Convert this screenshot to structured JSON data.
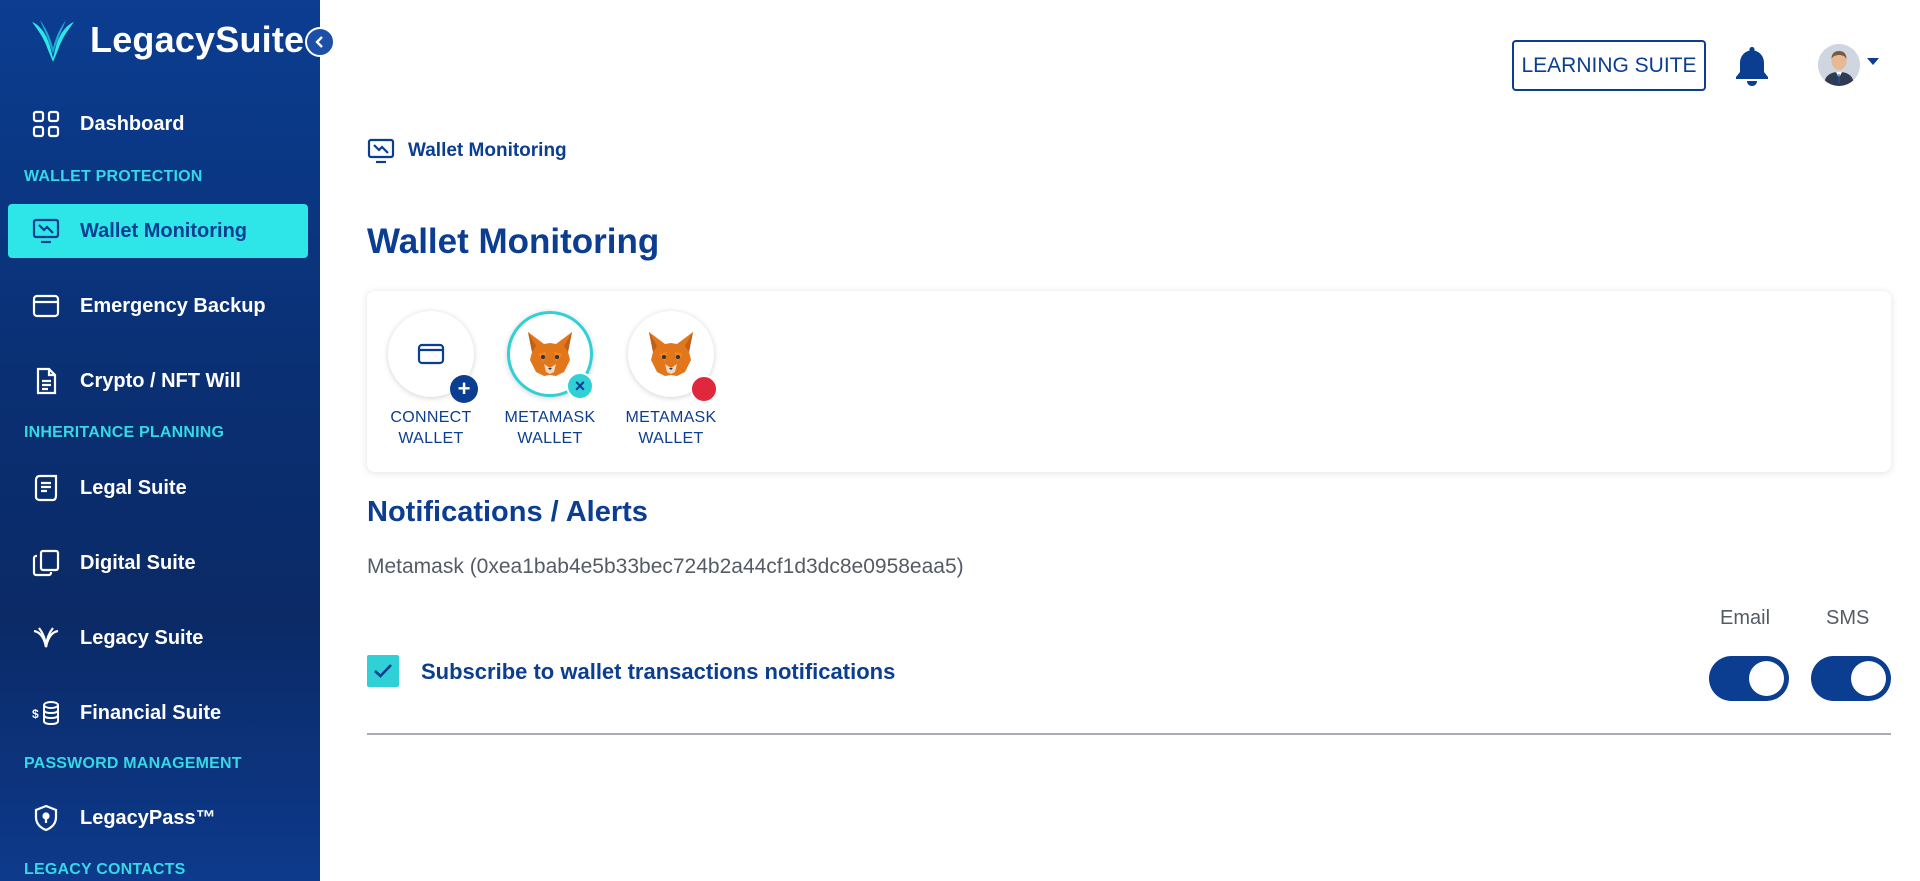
{
  "brand": {
    "name": "LegacySuite"
  },
  "sidebar": {
    "dashboard": "Dashboard",
    "sections": {
      "wallet_protection": "WALLET PROTECTION",
      "inheritance_planning": "INHERITANCE PLANNING",
      "password_management": "PASSWORD MANAGEMENT",
      "legacy_contacts": "LEGACY CONTACTS"
    },
    "items": {
      "wallet_monitoring": "Wallet Monitoring",
      "emergency_backup": "Emergency Backup",
      "crypto_nft_will": "Crypto / NFT Will",
      "legal_suite": "Legal Suite",
      "digital_suite": "Digital Suite",
      "legacy_suite": "Legacy Suite",
      "financial_suite": "Financial Suite",
      "legacypass": "LegacyPass™"
    },
    "active_item": "wallet_monitoring"
  },
  "header": {
    "learning_suite_label": "LEARNING SUITE"
  },
  "breadcrumb": {
    "label": "Wallet Monitoring"
  },
  "page": {
    "title": "Wallet Monitoring"
  },
  "wallets": [
    {
      "line1": "CONNECT",
      "line2": "WALLET",
      "icon": "wallet-add-icon"
    },
    {
      "line1": "METAMASK",
      "line2": "WALLET",
      "icon": "metamask-fox-icon",
      "status": "selected"
    },
    {
      "line1": "METAMASK",
      "line2": "WALLET",
      "icon": "metamask-fox-icon",
      "status": "disconnected"
    }
  ],
  "notifications": {
    "title": "Notifications / Alerts",
    "wallet_address": "Metamask (0xea1bab4e5b33bec724b2a44cf1d3dc8e0958eaa5)",
    "col_email": "Email",
    "col_sms": "SMS",
    "subscribe_label": "Subscribe to wallet transactions notifications",
    "subscribed": true,
    "email_enabled": true,
    "sms_enabled": true
  },
  "colors": {
    "brand_blue": "#0b3d91",
    "accent_cyan": "#2ee6e8",
    "section_label": "#36d8e6",
    "alert_red": "#e0283c"
  }
}
